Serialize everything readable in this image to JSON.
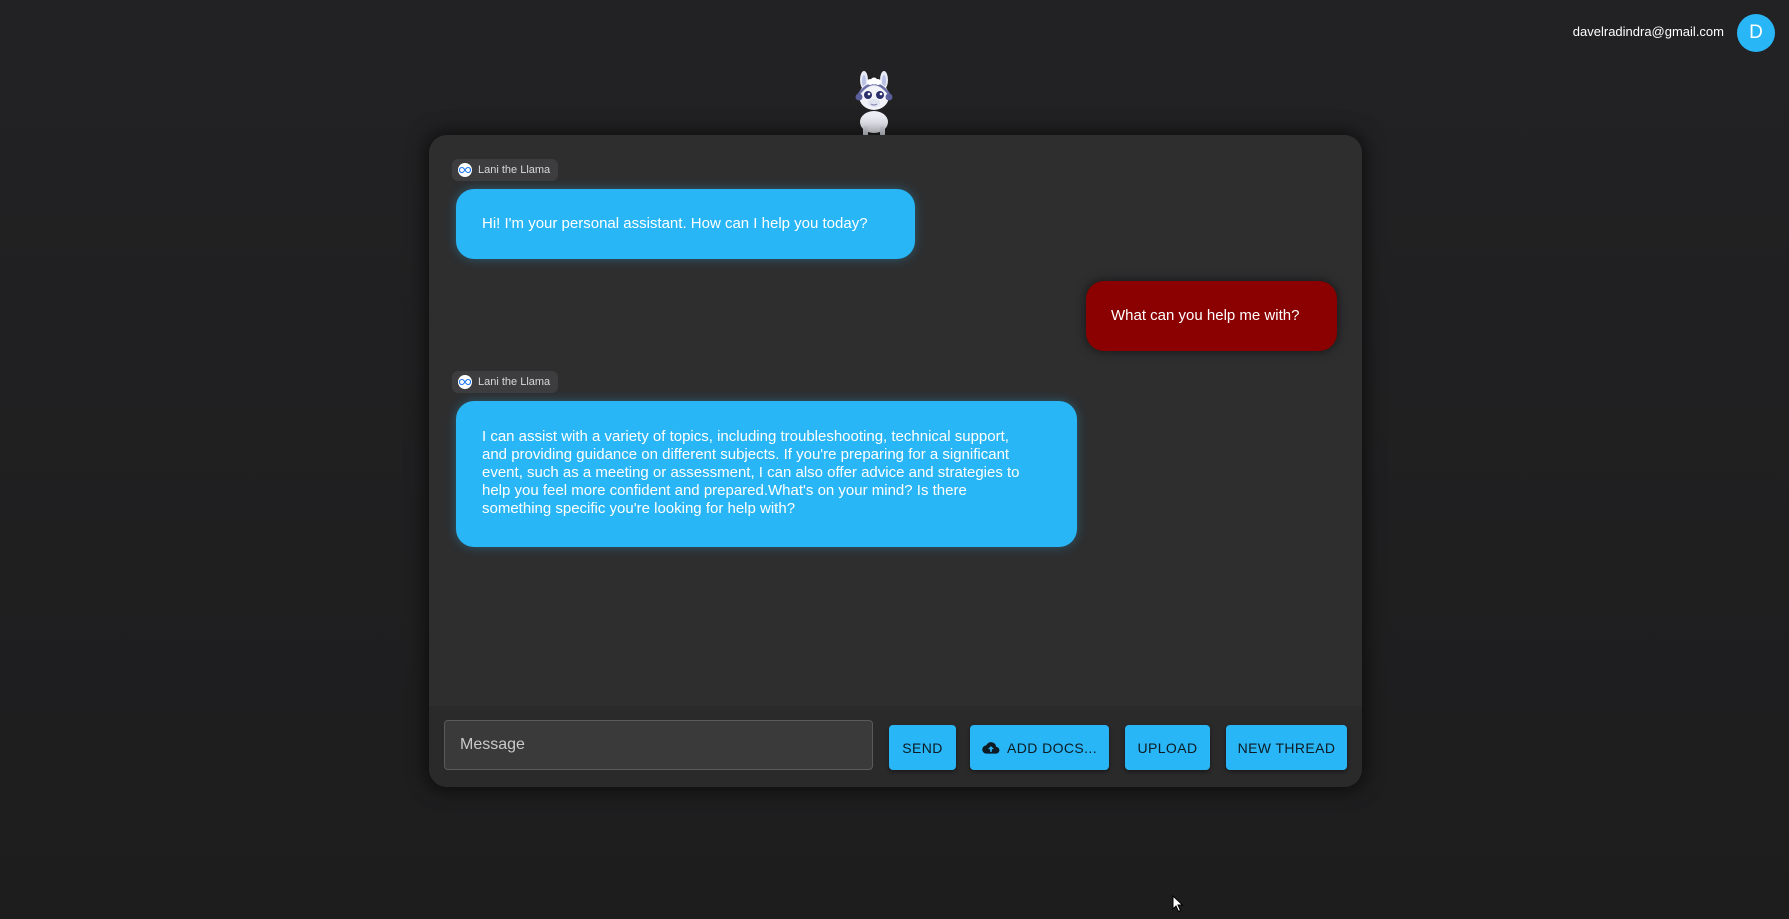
{
  "header": {
    "user_email": "davelradindra@gmail.com",
    "avatar_initial": "D"
  },
  "mascot": {
    "name": "llama-mascot"
  },
  "messages": [
    {
      "role": "bot",
      "sender": "Lani the Llama",
      "text": "Hi! I'm your personal assistant. How can I help you today?"
    },
    {
      "role": "user",
      "text": "What can you help me with?"
    },
    {
      "role": "bot",
      "sender": "Lani the Llama",
      "lines": [
        "I can assist with a variety of topics, including troubleshooting, technical support,",
        "and providing guidance on different subjects. If you're preparing for a significant",
        "event, such as a meeting or assessment, I can also offer advice and strategies to",
        "help you feel more confident and prepared.What's on your mind? Is there",
        "something specific you're looking for help with?"
      ]
    }
  ],
  "composer": {
    "placeholder": "Message",
    "send_label": "SEND",
    "add_docs_label": "ADD DOCS...",
    "upload_label": "UPLOAD",
    "new_thread_label": "NEW THREAD"
  },
  "colors": {
    "accent": "#29b6f6",
    "user_bubble": "#8b0000",
    "background": "#1f1f20",
    "card": "#2c2c2d"
  }
}
